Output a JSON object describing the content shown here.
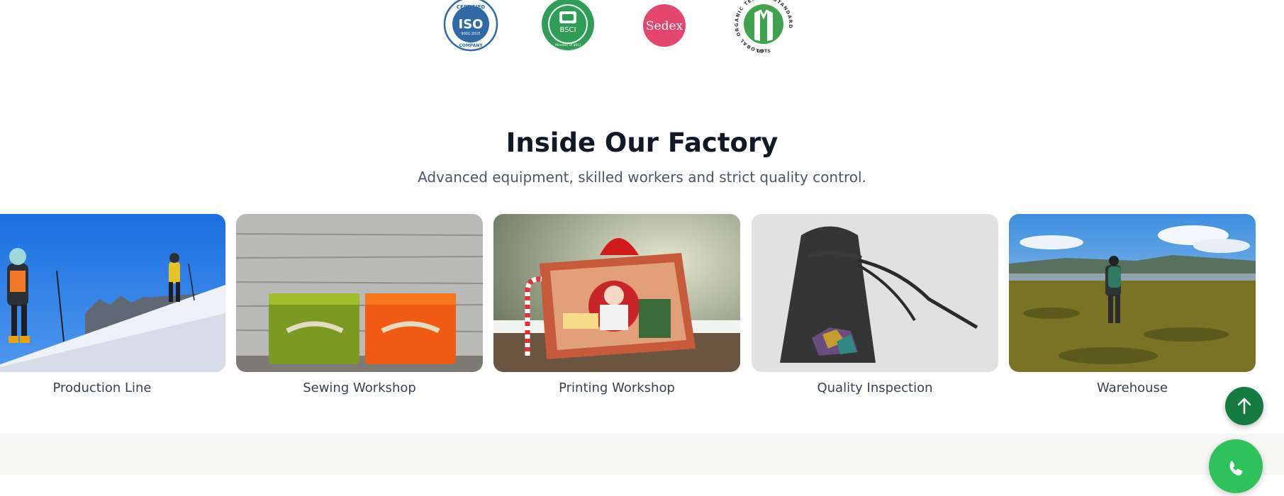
{
  "certifications": [
    {
      "name": "ISO",
      "icon": "iso-certified-badge-icon",
      "top_text": "CERTIFIED",
      "mid_text": "ISO",
      "sub_text": "9001:2015",
      "bottom_text": "COMPANY",
      "color": "#2f6aa6"
    },
    {
      "name": "BSCI",
      "icon": "bsci-badge-icon",
      "mid_text": "BSCI",
      "ring_text": "Member of BSCI",
      "color": "#2e9d55"
    },
    {
      "name": "Sedex",
      "icon": "sedex-badge-icon",
      "mid_text": "Sedex",
      "color": "#e5466e"
    },
    {
      "name": "GOTS",
      "icon": "gots-badge-icon",
      "ring_text": "GLOBAL ORGANIC TEXTILE STANDARD",
      "bottom_text": "GOTS",
      "color": "#3fa34d"
    }
  ],
  "factory": {
    "title": "Inside Our Factory",
    "subtitle": "Advanced equipment, skilled workers and strict quality control.",
    "cards": [
      {
        "caption": "Production Line"
      },
      {
        "caption": "Sewing Workshop"
      },
      {
        "caption": "Printing Workshop"
      },
      {
        "caption": "Quality Inspection"
      },
      {
        "caption": "Warehouse"
      }
    ]
  },
  "floating": {
    "to_top_icon": "arrow-up-icon",
    "whatsapp_icon": "phone-icon",
    "to_top_color": "#157a3f",
    "whatsapp_color": "#2fc25b"
  }
}
